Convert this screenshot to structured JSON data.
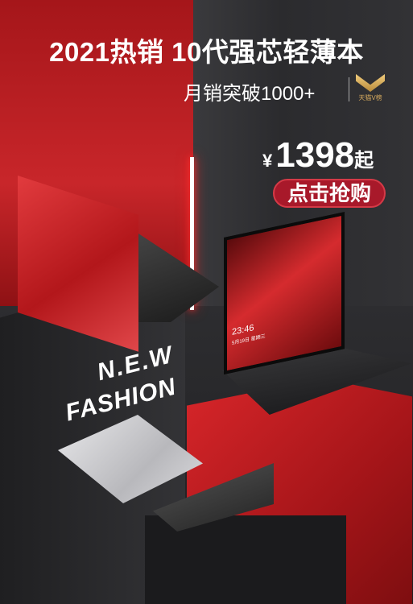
{
  "headline": "2021热销 10代强芯轻薄本",
  "sales": "月销突破1000+",
  "badge": {
    "text": "天猫V榜",
    "icon": "tmall-v-icon"
  },
  "price": {
    "currency": "¥",
    "amount": "1398",
    "suffix": "起"
  },
  "cta": "点击抢购",
  "slogan": {
    "line1": "N.E.W",
    "line2": "FASHION"
  },
  "screen": {
    "time": "23:46",
    "date": "5月19日 星期三"
  },
  "colors": {
    "red": "#c8262a",
    "dark": "#2a2a2c",
    "cta": "#a8192a",
    "gold": "#d6aa5e"
  }
}
